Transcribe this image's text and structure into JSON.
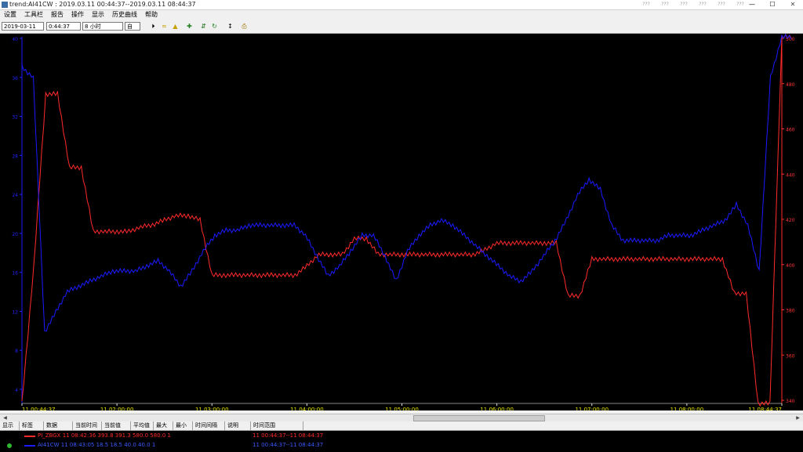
{
  "window": {
    "title": "trend:AI41CW : 2019.03.11 00:44:37--2019.03.11 08:44:37",
    "controls": [
      "—",
      "☐",
      "✕"
    ]
  },
  "graybtns": [
    "???",
    "???",
    "???",
    "???",
    "???",
    "???"
  ],
  "menu": [
    "设置",
    "工具栏",
    "报告",
    "操作",
    "显示",
    "历史曲线",
    "帮助"
  ],
  "toolbar": {
    "date_value": "2019-03-11",
    "time_value": "0:44:37",
    "duration_value": "8 小时",
    "mode_value": "自"
  },
  "chart_data": {
    "type": "line",
    "title": "",
    "x_ticks": [
      "11 00:44:37",
      "11 02:00:00",
      "11 03:00:00",
      "11 04:00:00",
      "11 05:00:00",
      "11 06:00:00",
      "11 07:00:00",
      "11 08:00:00",
      "11 08:44:37"
    ],
    "left_axis": {
      "ticks": [
        "40",
        "36",
        "32",
        "28",
        "24",
        "20",
        "16",
        "12",
        "8",
        "4"
      ],
      "color": "#2222ff"
    },
    "right_axis": {
      "ticks": [
        "500",
        "480",
        "460",
        "440",
        "420",
        "400",
        "380",
        "360",
        "340"
      ],
      "color": "#ff3333"
    },
    "series": [
      {
        "name": "PI_ZBGX",
        "color": "#ff2a2a",
        "axis": "right",
        "values": [
          280,
          400,
          475,
          475,
          443,
          443,
          415,
          415,
          415,
          415,
          417,
          418,
          420,
          422,
          422,
          420,
          396,
          396,
          396,
          396,
          396,
          396,
          396,
          396,
          400,
          405,
          405,
          405,
          412,
          412,
          405,
          405,
          405,
          405,
          405,
          405,
          405,
          405,
          405,
          407,
          410,
          410,
          410,
          410,
          410,
          410,
          387,
          387,
          403,
          403,
          403,
          403,
          403,
          403,
          403,
          403,
          403,
          403,
          403,
          403,
          388,
          388,
          280,
          280,
          500
        ]
      },
      {
        "name": "AI41CW",
        "color": "#1a1aff",
        "axis": "left",
        "values": [
          37,
          36,
          11,
          13,
          15,
          15.5,
          16,
          16.5,
          17,
          17,
          17,
          17.5,
          18,
          17,
          15.5,
          17,
          19,
          20.5,
          21,
          21,
          21.5,
          21.5,
          21.5,
          21.5,
          21.5,
          20.5,
          18.5,
          16.5,
          17.5,
          19,
          20.5,
          20.5,
          18.5,
          16,
          19,
          20.5,
          21.5,
          22,
          21.5,
          20.5,
          19.5,
          18.5,
          17.5,
          16.5,
          16,
          17,
          18.5,
          20,
          22,
          24.5,
          26,
          25,
          21.5,
          20,
          20,
          20,
          20,
          20.5,
          20.5,
          20.5,
          21,
          21.5,
          22,
          23.5,
          21.5,
          17,
          36,
          42
        ]
      }
    ]
  },
  "table": {
    "headers": [
      "显示",
      "标签",
      "数据",
      "当前时间",
      "当前值",
      "平均值",
      "最大",
      "最小",
      "时间间隔",
      "说明",
      "时间范围"
    ],
    "rows": [
      {
        "text": "PI_ZBGX  11 08:42:36  393.8    391.3    580.0  580.0   1",
        "range": "11 00:44:37--11 08:44:37",
        "color": "#ff2a2a"
      },
      {
        "text": "AI41CW  11 08:43:05  18.5     18.5     40.0   40.0    1",
        "range": "11 00:44:37--11 08:44:37",
        "color": "#1a1aff"
      }
    ]
  }
}
